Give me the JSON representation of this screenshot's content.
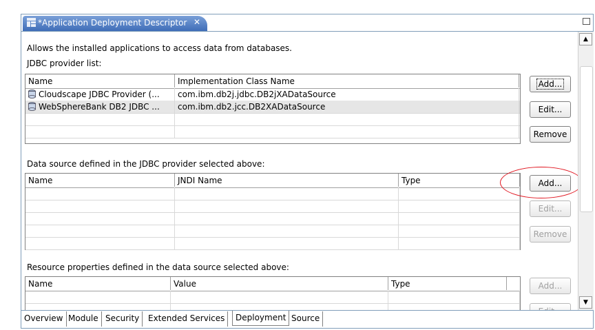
{
  "editor": {
    "tab_title": "*Application Deployment Descriptor",
    "tab_icon": "deployment-descriptor-icon",
    "close_icon": "close-icon",
    "maximize_icon": "maximize-icon"
  },
  "description": "Allows the installed applications to access data from databases.",
  "jdbc": {
    "label": "JDBC provider list:",
    "columns": [
      "Name",
      "Implementation Class Name"
    ],
    "rows": [
      {
        "name": "Cloudscape JDBC Provider (...",
        "class": "com.ibm.db2j.jdbc.DB2jXADataSource"
      },
      {
        "name": "WebSphereBank DB2 JDBC ...",
        "class": "com.ibm.db2.jcc.DB2XADataSource"
      }
    ],
    "buttons": {
      "add": "Add...",
      "edit": "Edit...",
      "remove": "Remove"
    }
  },
  "datasource": {
    "label": "Data source defined in the JDBC provider selected above:",
    "columns": [
      "Name",
      "JNDI Name",
      "Type"
    ],
    "buttons": {
      "add": "Add...",
      "edit": "Edit...",
      "remove": "Remove"
    }
  },
  "resource": {
    "label": "Resource properties defined in the data source selected above:",
    "columns": [
      "Name",
      "Value",
      "Type"
    ],
    "buttons": {
      "add": "Add...",
      "edit": "Edit..."
    }
  },
  "bottom_tabs": [
    "Overview",
    "Module",
    "Security",
    "Extended Services",
    "Deployment",
    "Source"
  ],
  "active_tab": "Deployment",
  "colors": {
    "accent": "#3f6db8",
    "callout": "#e0141e",
    "selection": "#e6e6e6"
  }
}
